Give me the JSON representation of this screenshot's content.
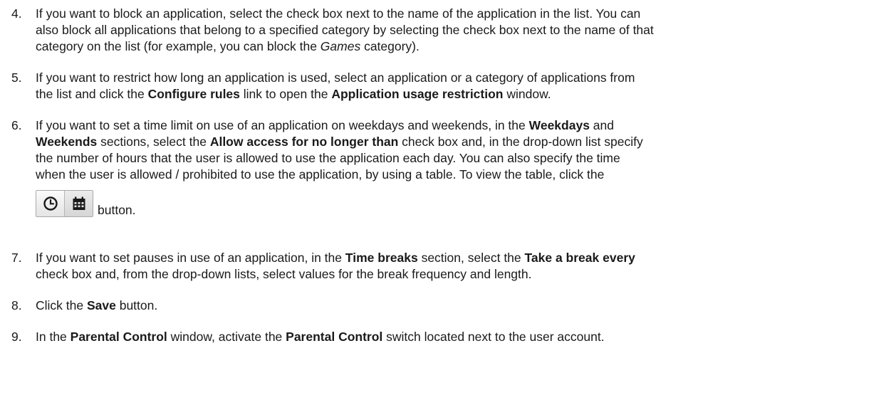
{
  "steps": [
    {
      "number": "4.",
      "lines": [
        [
          {
            "t": "If you want to block an application, select the check box next to the name of the application in the list. You can",
            "s": "n"
          }
        ],
        [
          {
            "t": "also block all applications that belong to a specified category by selecting the check box next to the name of that",
            "s": "n"
          }
        ],
        [
          {
            "t": "category on the list (for example, you can block the ",
            "s": "n"
          },
          {
            "t": "Games",
            "s": "i"
          },
          {
            "t": " category).",
            "s": "n"
          }
        ]
      ]
    },
    {
      "number": "5.",
      "lines": [
        [
          {
            "t": "If you want to restrict how long an application is used, select an application or a category of applications from",
            "s": "n"
          }
        ],
        [
          {
            "t": "the list and click the ",
            "s": "n"
          },
          {
            "t": "Configure rules",
            "s": "b"
          },
          {
            "t": " link to open the ",
            "s": "n"
          },
          {
            "t": "Application usage restriction",
            "s": "b"
          },
          {
            "t": " window.",
            "s": "n"
          }
        ]
      ]
    },
    {
      "number": "6.",
      "lines": [
        [
          {
            "t": "If you want to set a time limit on use of an application on weekdays and weekends, in the ",
            "s": "n"
          },
          {
            "t": "Weekdays",
            "s": "b"
          },
          {
            "t": " and",
            "s": "n"
          }
        ],
        [
          {
            "t": "Weekends",
            "s": "b"
          },
          {
            "t": " sections, select the ",
            "s": "n"
          },
          {
            "t": "Allow access for no longer than",
            "s": "b"
          },
          {
            "t": " check box and, in the drop-down list specify",
            "s": "n"
          }
        ],
        [
          {
            "t": "the number of hours that the user is allowed to use the application each day. You can also specify the time",
            "s": "n"
          }
        ],
        [
          {
            "t": "when the user is allowed / prohibited to use the application, by using a table. To view the table, click the",
            "s": "n"
          }
        ]
      ],
      "after_button": "button.",
      "button_icons": [
        "clock-icon",
        "calendar-icon"
      ]
    },
    {
      "number": "7.",
      "lines": [
        [
          {
            "t": "If you want to set pauses in use of an application, in the ",
            "s": "n"
          },
          {
            "t": "Time breaks",
            "s": "b"
          },
          {
            "t": " section, select the ",
            "s": "n"
          },
          {
            "t": "Take a break every",
            "s": "b"
          }
        ],
        [
          {
            "t": "check box and, from the drop-down lists, select values for the break frequency and length.",
            "s": "n"
          }
        ]
      ]
    },
    {
      "number": "8.",
      "lines": [
        [
          {
            "t": "Click the ",
            "s": "n"
          },
          {
            "t": "Save",
            "s": "b"
          },
          {
            "t": " button.",
            "s": "n"
          }
        ]
      ]
    },
    {
      "number": "9.",
      "lines": [
        [
          {
            "t": "In the ",
            "s": "n"
          },
          {
            "t": "Parental Control",
            "s": "b"
          },
          {
            "t": " window, activate the ",
            "s": "n"
          },
          {
            "t": "Parental Control",
            "s": "b"
          },
          {
            "t": " switch located next to the user account.",
            "s": "n"
          }
        ]
      ]
    }
  ]
}
